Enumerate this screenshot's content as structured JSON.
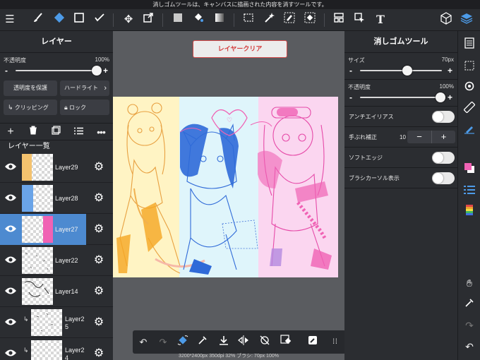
{
  "status_bar": {
    "message": "消しゴムツールは、キャンバスに描画された内容を消すツールです。"
  },
  "toolbar": {
    "icons": [
      "menu-icon",
      "brush-icon",
      "eraser-icon",
      "square-icon",
      "check-brush-icon",
      "move-icon",
      "transform-icon",
      "fill-color-icon",
      "bucket-icon",
      "gradient-icon",
      "selection-icon",
      "magic-wand-icon",
      "select-pen-icon",
      "select-eraser-icon",
      "layout-icon",
      "cursor-icon",
      "text-icon",
      "3d-cube-icon",
      "layers-icon"
    ]
  },
  "left_panel": {
    "title": "レイヤー",
    "opacity_label": "不透明度",
    "opacity_value": "100%",
    "protect_alpha": "透明度を保護",
    "blend_mode": "ハードライト",
    "clipping": "クリッピング",
    "lock": "ロック",
    "list_title": "レイヤー一覧",
    "layers": [
      {
        "name": "Layer29",
        "visible": true,
        "thumb_color": "#f4c26e"
      },
      {
        "name": "Layer28",
        "visible": true,
        "thumb_color": "#6aa4e8"
      },
      {
        "name": "Layer27",
        "visible": true,
        "thumb_color": "#f062b4",
        "selected": true
      },
      {
        "name": "Layer22",
        "visible": true,
        "thumb_color": "#888888"
      },
      {
        "name": "Layer14",
        "visible": true,
        "thumb_color": "#555555"
      },
      {
        "name": "Layer25",
        "visible": true,
        "clipped": true
      },
      {
        "name": "Layer24",
        "visible": true,
        "clipped": true
      }
    ]
  },
  "canvas": {
    "clear_button": "レイヤークリア",
    "status": "3200*2400px 350dpi 32% ブラシ: 70px 100%"
  },
  "right_panel": {
    "title": "消しゴムツール",
    "size_label": "サイズ",
    "size_value": "70px",
    "opacity_label": "不透明度",
    "opacity_value": "100%",
    "antialias": "アンチエイリアス",
    "stabilizer_label": "手ぶれ補正",
    "stabilizer_value": "10",
    "soft_edge": "ソフトエッジ",
    "brush_cursor": "ブラシカーソル表示"
  },
  "colors": {
    "accent": "#4d8ad0",
    "clear_button_text": "#d43c3c",
    "panel_bg": "#2b2d31",
    "canvas_bg": "#5a5c60"
  }
}
